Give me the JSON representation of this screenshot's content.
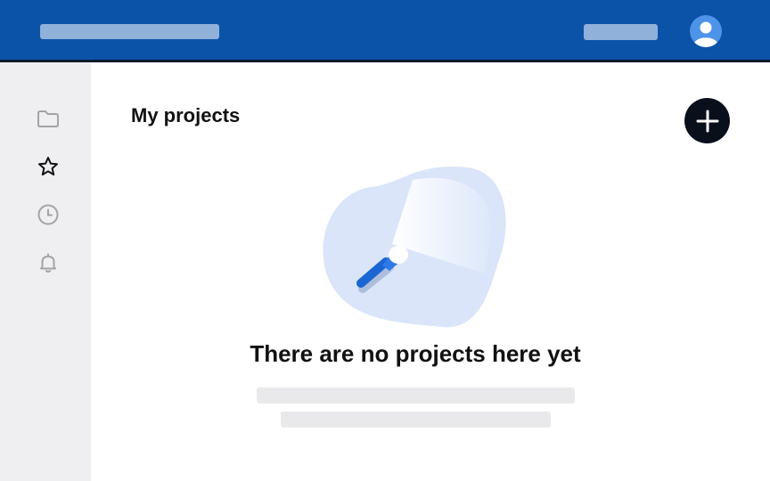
{
  "header": {
    "avatar_icon": "user-avatar-icon",
    "color": "#0b53a8"
  },
  "sidebar": {
    "items": [
      {
        "icon": "folder-icon",
        "active": false
      },
      {
        "icon": "star-icon",
        "active": true
      },
      {
        "icon": "clock-icon",
        "active": false
      },
      {
        "icon": "bell-icon",
        "active": false
      }
    ]
  },
  "main": {
    "title": "My projects",
    "add_icon": "plus-icon",
    "empty_state": {
      "illustration": "flashlight-icon",
      "heading": "There are no projects here yet"
    }
  },
  "colors": {
    "accent": "#0b53a8",
    "add_button": "#0a0f1c",
    "sidebar_bg": "#efeff1",
    "placeholder": "#e9e9eb"
  }
}
